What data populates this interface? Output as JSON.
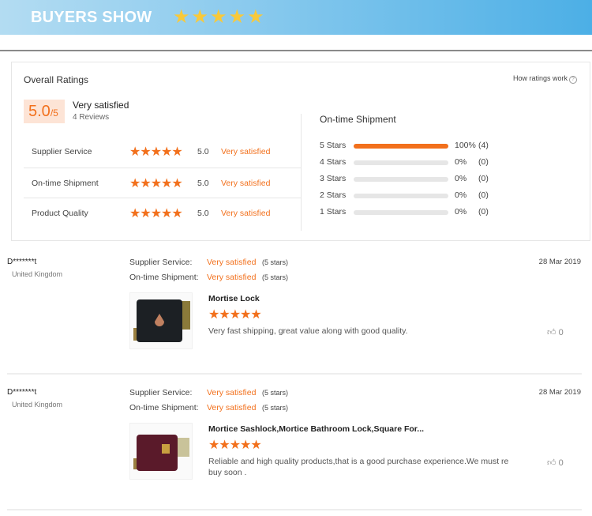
{
  "banner": {
    "title": "BUYERS SHOW",
    "stars": "★★★★★"
  },
  "overall": {
    "title": "Overall Ratings",
    "how_link": "How ratings work",
    "help_icon": "?",
    "score": "5.0",
    "score_max": "/5",
    "summary": "Very satisfied",
    "reviews": "4 Reviews",
    "rows": [
      {
        "label": "Supplier Service",
        "stars": "★★★★★",
        "score": "5.0",
        "text": "Very satisfied"
      },
      {
        "label": "On-time Shipment",
        "stars": "★★★★★",
        "score": "5.0",
        "text": "Very satisfied"
      },
      {
        "label": "Product Quality",
        "stars": "★★★★★",
        "score": "5.0",
        "text": "Very satisfied"
      }
    ]
  },
  "breakdown": {
    "title": "On-time Shipment",
    "rows": [
      {
        "label": "5 Stars",
        "percent": 100,
        "pct_text": "100%",
        "count": "(4)"
      },
      {
        "label": "4 Stars",
        "percent": 0,
        "pct_text": "0%",
        "count": "(0)"
      },
      {
        "label": "3 Stars",
        "percent": 0,
        "pct_text": "0%",
        "count": "(0)"
      },
      {
        "label": "2 Stars",
        "percent": 0,
        "pct_text": "0%",
        "count": "(0)"
      },
      {
        "label": "1 Stars",
        "percent": 0,
        "pct_text": "0%",
        "count": "(0)"
      }
    ]
  },
  "reviews": [
    {
      "name": "D*******t",
      "country": "United Kingdom",
      "supplier_label": "Supplier Service:",
      "supplier_val": "Very satisfied",
      "supplier_stars": "(5 stars)",
      "ship_label": "On-time Shipment:",
      "ship_val": "Very satisfied",
      "ship_stars": "(5 stars)",
      "date": "28 Mar 2019",
      "product": "Mortise Lock",
      "stars": "★★★★★",
      "text": "Very fast shipping, great value along with good quality.",
      "likes": "0"
    },
    {
      "name": "D*******t",
      "country": "United Kingdom",
      "supplier_label": "Supplier Service:",
      "supplier_val": "Very satisfied",
      "supplier_stars": "(5 stars)",
      "ship_label": "On-time Shipment:",
      "ship_val": "Very satisfied",
      "ship_stars": "(5 stars)",
      "date": "28 Mar 2019",
      "product": "Mortice Sashlock,Mortice Bathroom Lock,Square For...",
      "stars": "★★★★★",
      "text": "Reliable and high quality products,that is a good purchase experience.We must re buy soon .",
      "likes": "0"
    }
  ]
}
